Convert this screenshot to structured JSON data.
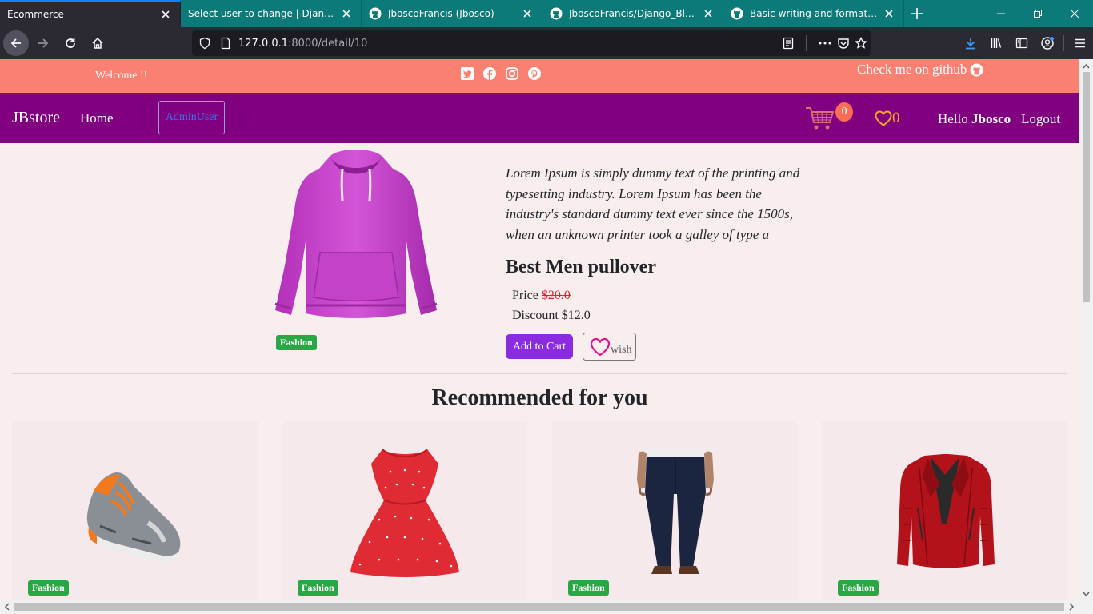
{
  "browser": {
    "tabs": [
      {
        "title": "Ecommerce",
        "active": true
      },
      {
        "title": "Select user to change | Django site admin",
        "active": false
      },
      {
        "title": "JboscoFrancis (Jbosco)",
        "active": false
      },
      {
        "title": "JboscoFrancis/Django_BlogChallenge",
        "active": false
      },
      {
        "title": "Basic writing and formatting syntax",
        "active": false
      }
    ],
    "url_host": "127.0.0.1",
    "url_path": ":8000/detail/10"
  },
  "topbar": {
    "welcome": "Welcome !!",
    "github": "Check me on github",
    "socials": [
      "twitter-icon",
      "facebook-icon",
      "instagram-icon",
      "pinterest-icon"
    ]
  },
  "nav": {
    "brand": "JBstore",
    "home": "Home",
    "admin": "AdminUser",
    "cart_count": "0",
    "wish_count": "0",
    "hello": "Hello",
    "username": "Jbosco",
    "logout": "Logout"
  },
  "product": {
    "description": "Lorem Ipsum is simply dummy text of the printing and typesetting industry. Lorem Ipsum has been the industry's standard dummy text ever since the 1500s, when an unknown printer took a galley of type a",
    "title": "Best Men pullover",
    "price_label": "Price",
    "price": "$20.0",
    "discount_label": "Discount",
    "discount": "$12.0",
    "category": "Fashion",
    "add_to_cart": "Add to Cart",
    "wish": "wish"
  },
  "recommended": {
    "title": "Recommended for you",
    "items": [
      {
        "category": "Fashion",
        "image": "sneaker"
      },
      {
        "category": "Fashion",
        "image": "red-dress"
      },
      {
        "category": "Fashion",
        "image": "navy-trousers"
      },
      {
        "category": "Fashion",
        "image": "red-leather-jacket"
      }
    ]
  },
  "colors": {
    "topbar": "#fa8072",
    "navbar": "#800080",
    "page_bg": "#f9eeee",
    "badge": "#28a745",
    "add_cart": "#8a2be2"
  }
}
